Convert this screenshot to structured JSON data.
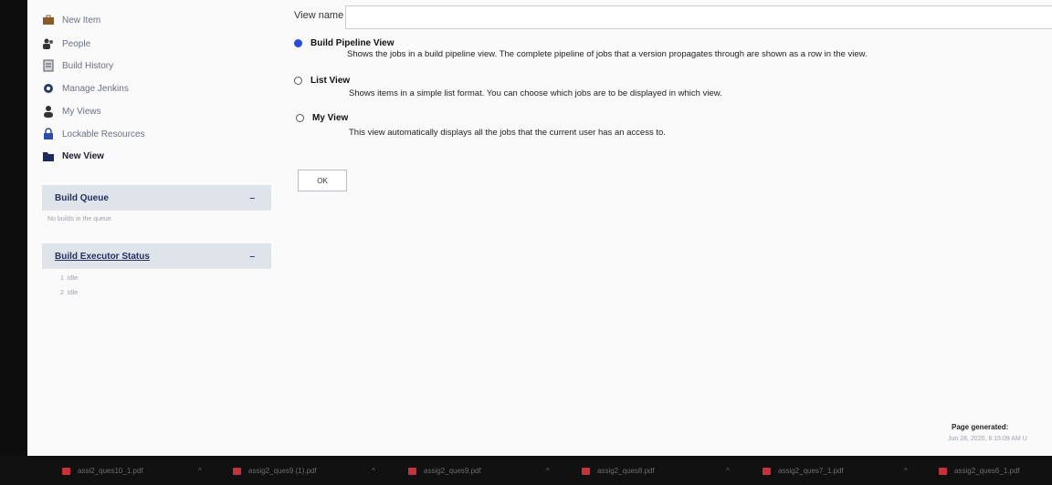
{
  "sidebar": {
    "tasks": [
      {
        "label": "New Item",
        "icon": "briefcase-icon"
      },
      {
        "label": "People",
        "icon": "people-icon"
      },
      {
        "label": "Build History",
        "icon": "notepad-icon"
      },
      {
        "label": "Manage Jenkins",
        "icon": "gear-icon"
      },
      {
        "label": "My Views",
        "icon": "user-icon"
      },
      {
        "label": "Lockable Resources",
        "icon": "lock-icon"
      },
      {
        "label": "New View",
        "icon": "folder-icon"
      }
    ],
    "build_queue": {
      "title": "Build Queue",
      "collapse": "–",
      "empty_text": "No builds in the queue."
    },
    "executor_status": {
      "title": "Build Executor Status",
      "collapse": "–",
      "executors": [
        {
          "num": "1",
          "status": "Idle"
        },
        {
          "num": "2",
          "status": "Idle"
        }
      ]
    }
  },
  "form": {
    "view_name_label": "View name",
    "view_name_value": "",
    "options": [
      {
        "label": "Build Pipeline View",
        "checked": true,
        "description": "Shows the jobs in a build pipeline view. The complete pipeline of jobs that a version propagates through are shown as a row in the view."
      },
      {
        "label": "List View",
        "checked": false,
        "description": "Shows items in a simple list format. You can choose which jobs are to be displayed in which view."
      },
      {
        "label": "My View",
        "checked": false,
        "description": "This view automatically displays all the jobs that the current user has an access to."
      }
    ],
    "ok_label": "OK"
  },
  "footer": {
    "page_generated_label": "Page generated:",
    "page_generated_value": "Jun 28, 2020, 8:15:09 AM U"
  },
  "downloads": [
    {
      "name": "assi2_ques10_1.pdf"
    },
    {
      "name": "assig2_ques9 (1).pdf"
    },
    {
      "name": "assig2_ques9.pdf"
    },
    {
      "name": "assig2_ques8.pdf"
    },
    {
      "name": "assig2_ques7_1.pdf"
    },
    {
      "name": "assig2_ques6_1.pdf"
    }
  ],
  "colors": {
    "accent": "#2c4bd6",
    "panel_header": "#dfe4ea",
    "pdf_icon": "#c7323a"
  }
}
